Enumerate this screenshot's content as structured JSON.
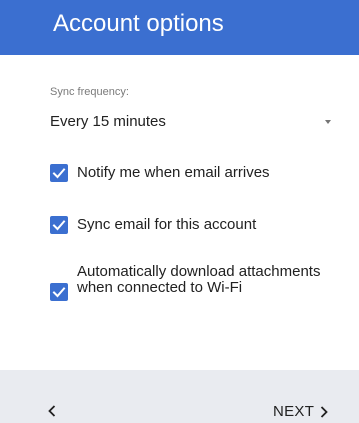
{
  "header": {
    "title": "Account options"
  },
  "sync": {
    "label": "Sync frequency:",
    "value": "Every 15 minutes"
  },
  "options": [
    {
      "label": "Notify me when email arrives",
      "checked": true
    },
    {
      "label": "Sync email for this account",
      "checked": true
    },
    {
      "label": "Automatically download attachments when connected to Wi-Fi",
      "checked": true
    }
  ],
  "footer": {
    "next_label": "NEXT"
  },
  "colors": {
    "accent": "#3b6fd0",
    "footer_bg": "#e9ebf0"
  },
  "icons": {
    "back": "chevron-left-icon",
    "next": "chevron-right-icon",
    "dropdown": "dropdown-arrow-icon",
    "checkbox": "checkmark-icon"
  }
}
